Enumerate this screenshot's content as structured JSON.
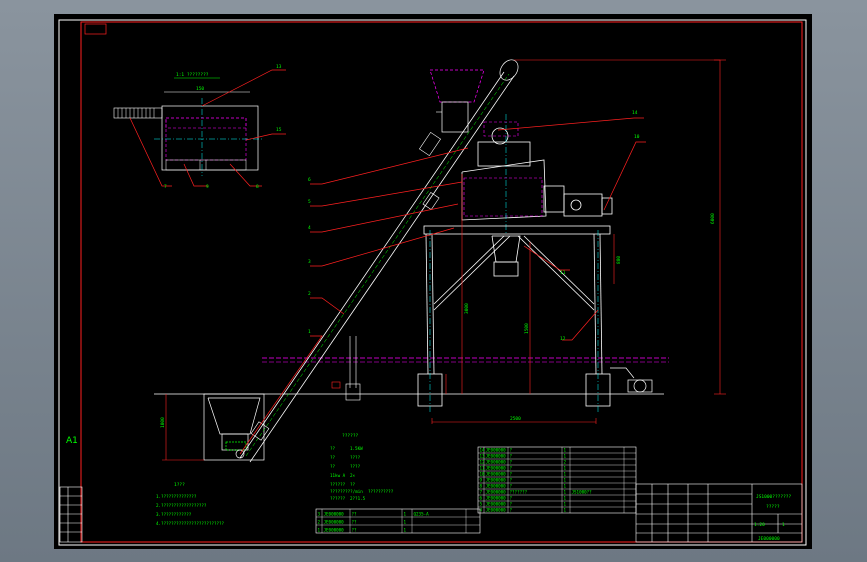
{
  "sheet": {
    "size_label": "A1",
    "top_detail_title": "1:1 ????????",
    "top_detail_dim": "150"
  },
  "callouts": {
    "c13": "13",
    "c15": "15",
    "c7": "7",
    "c9": "9",
    "c8": "8",
    "c14": "14",
    "c10": "10",
    "c6": "6",
    "c5": "5",
    "c4": "4",
    "c3": "3",
    "c2": "2",
    "c1": "1",
    "c11": "11",
    "c12": "12"
  },
  "tech_table": {
    "title": "??????",
    "rows": [
      [
        "??",
        "1.5KW"
      ],
      [
        "??",
        "????"
      ],
      [
        "??",
        "????"
      ],
      [
        "11kw  A",
        "2×"
      ],
      [
        "??????",
        "??"
      ],
      [
        "?????????/min",
        "??????????"
      ],
      [
        "??????",
        "2??1.5"
      ]
    ]
  },
  "notes": {
    "title": "1???",
    "lines": [
      "1.??????????????",
      "2.??????????????????",
      "3.????????????",
      "4.?????????????????????????"
    ]
  },
  "parts_list": [
    [
      "14",
      "JE000000",
      "?",
      "1",
      "",
      ""
    ],
    [
      "13",
      "JE000000",
      "?",
      "1",
      "",
      ""
    ],
    [
      "12",
      "JE000000",
      "?",
      "2",
      "",
      ""
    ],
    [
      "11",
      "JE000000",
      "?",
      "1",
      "",
      ""
    ],
    [
      "10",
      "JE000000",
      "?",
      "1",
      "",
      ""
    ],
    [
      "9",
      "JE000000",
      "?",
      "1",
      "",
      ""
    ],
    [
      "8",
      "JE000000",
      "?",
      "1",
      "",
      ""
    ],
    [
      "7",
      "JE000000",
      "???????",
      "1",
      "JS1000??",
      ""
    ],
    [
      "6",
      "JE000000",
      "?",
      "1",
      "",
      ""
    ],
    [
      "5",
      "JE000000",
      "?",
      "1",
      "",
      ""
    ],
    [
      "4",
      "JE000000",
      "?",
      "1",
      "",
      ""
    ]
  ],
  "lower_parts": [
    [
      "3",
      "JE000000",
      "??",
      "1",
      "Q235-A",
      ""
    ],
    [
      "2",
      "JE000000",
      "??",
      "1",
      "",
      ""
    ],
    [
      "1",
      "JE000000",
      "??",
      "1",
      "",
      ""
    ]
  ],
  "title_block": {
    "name": "JS1000???????",
    "sub": "?????",
    "drawing_no": "JE000000",
    "scale": "1:20",
    "sheet": "1"
  },
  "dims": {
    "height_total": "6000",
    "span_bottom": "2500",
    "left_pit": "1000",
    "col_h": "3000",
    "leg_h": "1500",
    "right_h": "880"
  },
  "colors": {
    "background": "#000000",
    "frame": "#ff0000",
    "outline": "#ffffff",
    "hidden": "#ff00ff",
    "center": "#00ffff",
    "text": "#00ff00"
  }
}
